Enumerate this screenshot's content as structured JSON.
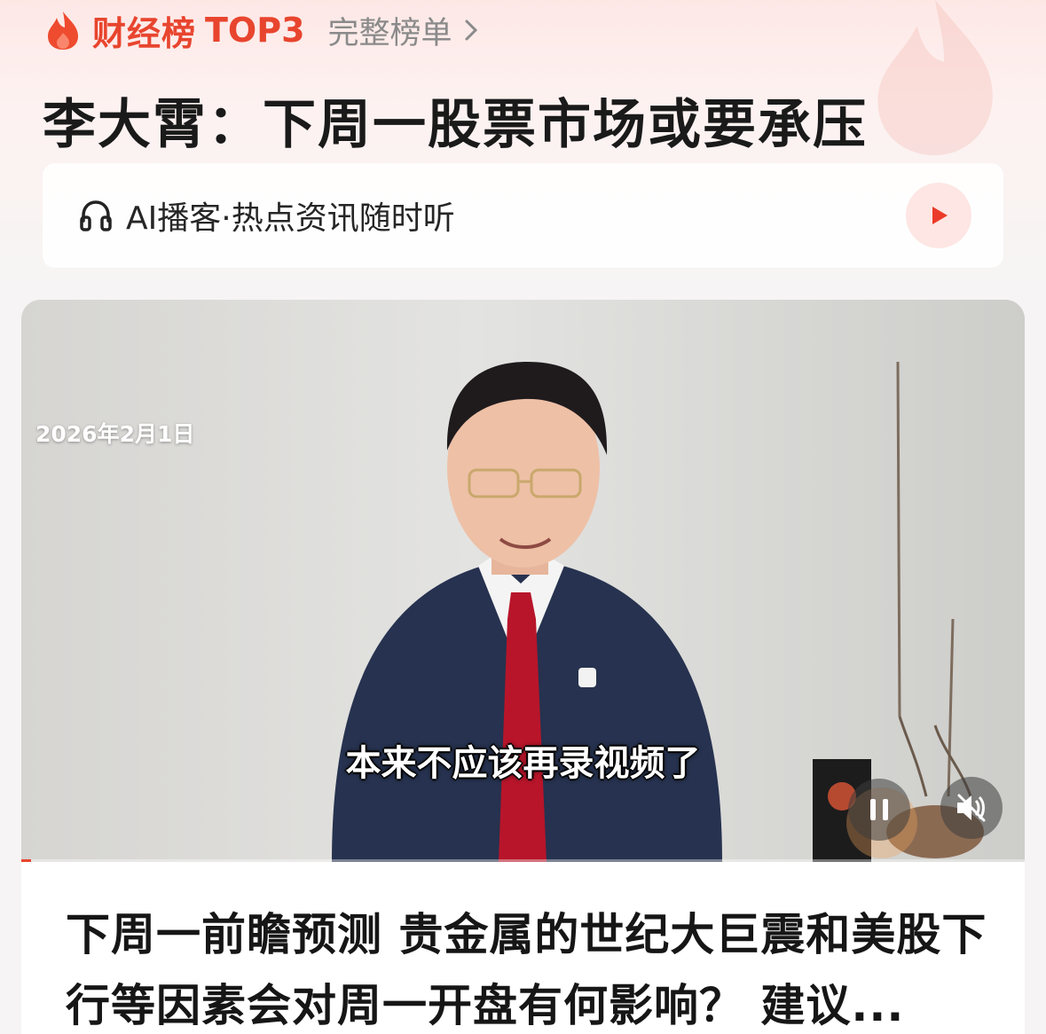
{
  "header": {
    "rank_label": "财经榜",
    "rank_tag": "TOP3",
    "full_list_label": "完整榜单"
  },
  "headline": "李大霄：下周一股票市场或要承压",
  "podcast": {
    "label": "AI播客·热点资讯随时听"
  },
  "video": {
    "date": "2026年2月1日",
    "subtitle": "本来不应该再录视频了",
    "progress": 0.01
  },
  "article": {
    "title": "下周一前瞻预测 贵金属的世纪大巨震和美股下行等因素会对周一开盘有何影响？ 建议..."
  },
  "colors": {
    "accent": "#e8452e",
    "play_bg": "#fde6e3"
  },
  "icons": {
    "flame": "flame-icon",
    "chevron": "chevron-right-icon",
    "headphone": "headphone-icon",
    "play": "play-icon",
    "pause": "pause-icon",
    "mute": "mute-icon"
  }
}
